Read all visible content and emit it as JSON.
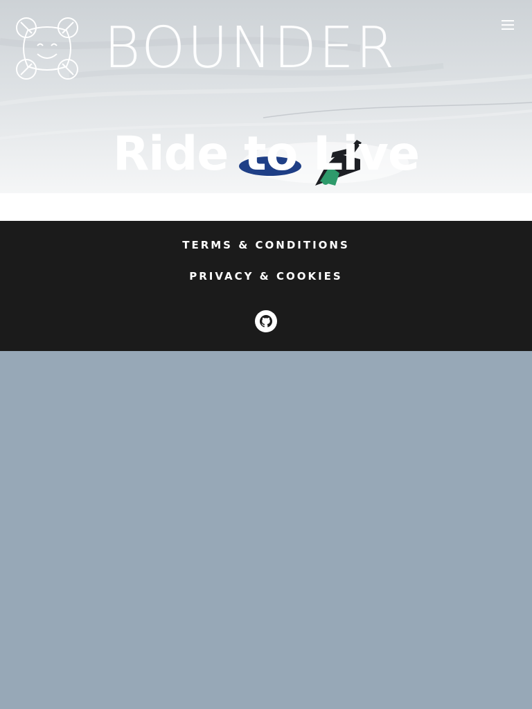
{
  "header": {
    "brand_name": "BOUNDER",
    "logo_icon": "smiley-face-logo-icon",
    "menu_icon": "hamburger-menu-icon"
  },
  "hero": {
    "title": "Ride to Live"
  },
  "footer": {
    "links": [
      {
        "label": "TERMS & CONDITIONS"
      },
      {
        "label": "PRIVACY & COOKIES"
      }
    ],
    "social_icon": "github-icon"
  },
  "colors": {
    "footer_background": "#1b1b1b",
    "page_background": "#97a8b7",
    "text_light": "#ffffff"
  }
}
